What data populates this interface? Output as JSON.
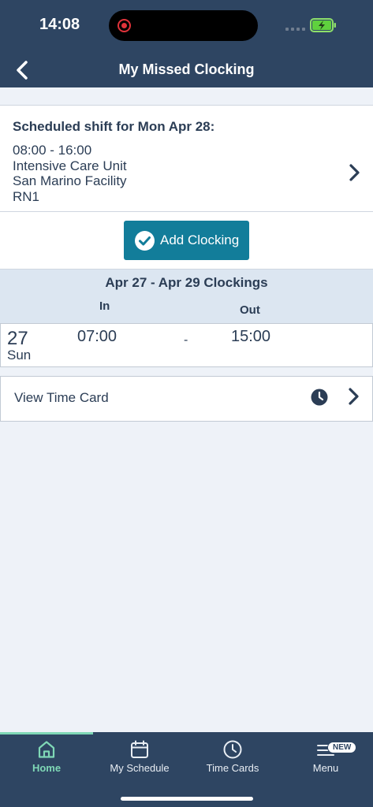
{
  "status_bar": {
    "time": "14:08"
  },
  "header": {
    "title": "My Missed Clocking",
    "back_icon": "chevron-left-icon"
  },
  "shift": {
    "heading": "Scheduled shift for Mon Apr 28:",
    "time_range": "08:00 - 16:00",
    "unit": "Intensive Care Unit",
    "facility": "San Marino Facility",
    "role": "RN1"
  },
  "actions": {
    "add_clocking_label": "Add Clocking"
  },
  "clockings": {
    "title": "Apr 27 - Apr 29 Clockings",
    "in_header": "In",
    "out_header": "Out",
    "rows": [
      {
        "day_num": "27",
        "day_name": "Sun",
        "in": "07:00",
        "sep": "-",
        "out": "15:00"
      }
    ]
  },
  "time_card": {
    "label": "View Time Card"
  },
  "tabs": [
    {
      "label": "Home",
      "icon": "home-icon"
    },
    {
      "label": "My Schedule",
      "icon": "calendar-icon"
    },
    {
      "label": "Time Cards",
      "icon": "clock-icon"
    },
    {
      "label": "Menu",
      "icon": "menu-icon",
      "badge": "NEW"
    }
  ],
  "colors": {
    "header_bg": "#2e4562",
    "accent": "#127d9a",
    "tab_active": "#7fd8b6"
  }
}
